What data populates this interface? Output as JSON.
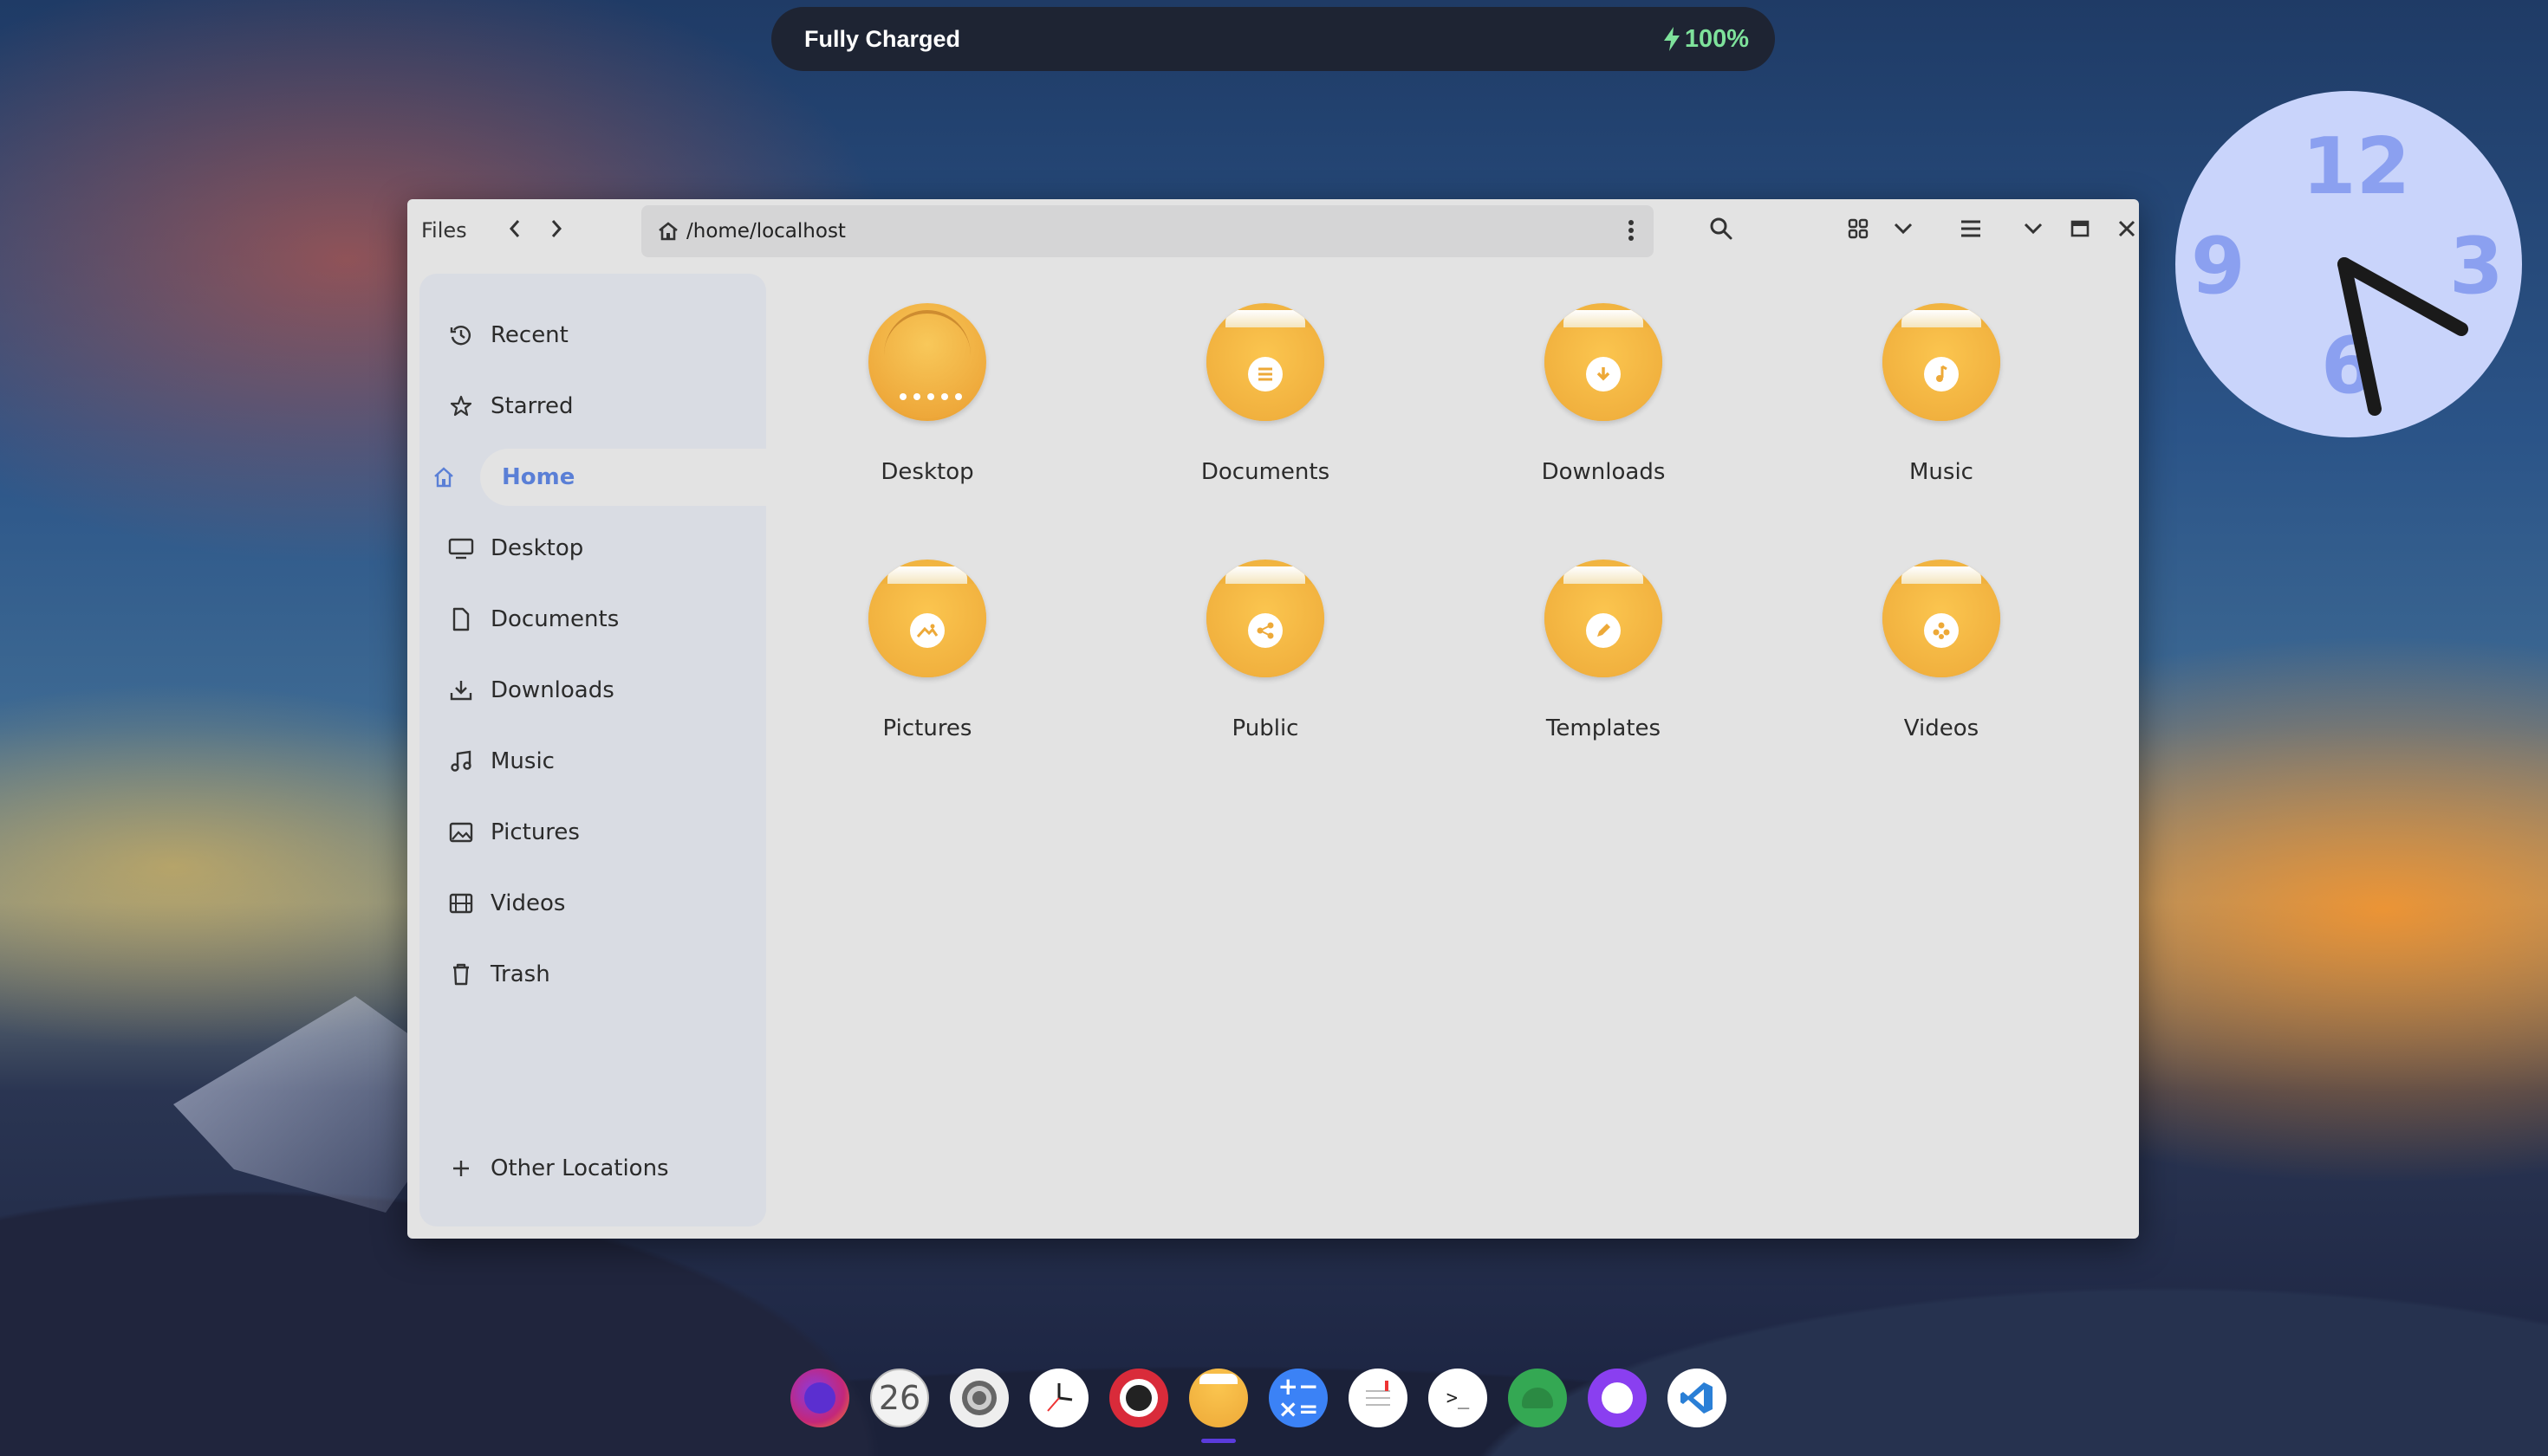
{
  "battery": {
    "status": "Fully Charged",
    "percent": "100%"
  },
  "clock": {
    "n12": "12",
    "n3": "3",
    "n6": "6",
    "n9": "9"
  },
  "window": {
    "app_title": "Files",
    "path": "/home/localhost"
  },
  "sidebar": {
    "items": [
      {
        "label": "Recent",
        "icon": "clock-history-icon"
      },
      {
        "label": "Starred",
        "icon": "star-icon"
      },
      {
        "label": "Home",
        "icon": "home-icon",
        "active": true
      },
      {
        "label": "Desktop",
        "icon": "monitor-icon"
      },
      {
        "label": "Documents",
        "icon": "document-icon"
      },
      {
        "label": "Downloads",
        "icon": "download-icon"
      },
      {
        "label": "Music",
        "icon": "music-note-icon"
      },
      {
        "label": "Pictures",
        "icon": "image-icon"
      },
      {
        "label": "Videos",
        "icon": "film-icon"
      },
      {
        "label": "Trash",
        "icon": "trash-icon"
      }
    ],
    "other_locations": "Other Locations"
  },
  "folders": [
    {
      "label": "Desktop",
      "icon": "desktop-folder-icon"
    },
    {
      "label": "Documents",
      "icon": "documents-folder-icon"
    },
    {
      "label": "Downloads",
      "icon": "downloads-folder-icon"
    },
    {
      "label": "Music",
      "icon": "music-folder-icon"
    },
    {
      "label": "Pictures",
      "icon": "pictures-folder-icon"
    },
    {
      "label": "Public",
      "icon": "public-folder-icon"
    },
    {
      "label": "Templates",
      "icon": "templates-folder-icon"
    },
    {
      "label": "Videos",
      "icon": "videos-folder-icon"
    }
  ],
  "dock": {
    "calendar_day": "26",
    "apps": [
      "firefox-icon",
      "calendar-icon",
      "settings-icon",
      "clocks-icon",
      "camera-icon",
      "files-icon",
      "calculator-icon",
      "text-editor-icon",
      "terminal-icon",
      "android-icon",
      "github-icon",
      "vscode-icon"
    ],
    "active_app": "files-icon",
    "colors": {
      "accent": "#5a3bdc",
      "folder": "#eca936",
      "battery": "#7ee29b"
    }
  }
}
